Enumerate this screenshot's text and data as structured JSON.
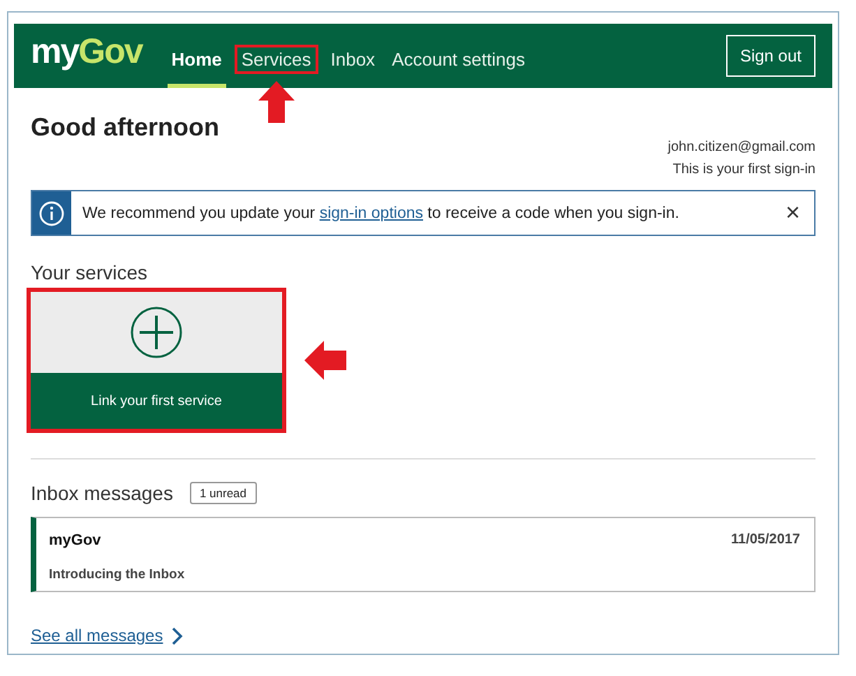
{
  "header": {
    "logo": {
      "first": "my",
      "second": "Gov"
    },
    "nav": [
      {
        "label": "Home",
        "selected": true,
        "highlighted": false
      },
      {
        "label": "Services",
        "selected": false,
        "highlighted": true
      },
      {
        "label": "Inbox",
        "selected": false,
        "highlighted": false
      },
      {
        "label": "Account settings",
        "selected": false,
        "highlighted": false
      }
    ],
    "sign_out": "Sign out"
  },
  "greeting": "Good afternoon",
  "account": {
    "email": "john.citizen@gmail.com",
    "note": "This is your first sign-in"
  },
  "alert": {
    "before": "We recommend you update your ",
    "link": "sign-in options",
    "after": " to receive a code when you sign-in.",
    "close": "×"
  },
  "services": {
    "heading": "Your services",
    "card": {
      "label": "Link your first service",
      "highlighted": true
    }
  },
  "inbox": {
    "heading": "Inbox messages",
    "badge": "1 unread",
    "messages": [
      {
        "sender": "myGov",
        "date": "11/05/2017",
        "subject": "Introducing the Inbox",
        "unread": true
      }
    ],
    "see_all": "See all messages"
  }
}
